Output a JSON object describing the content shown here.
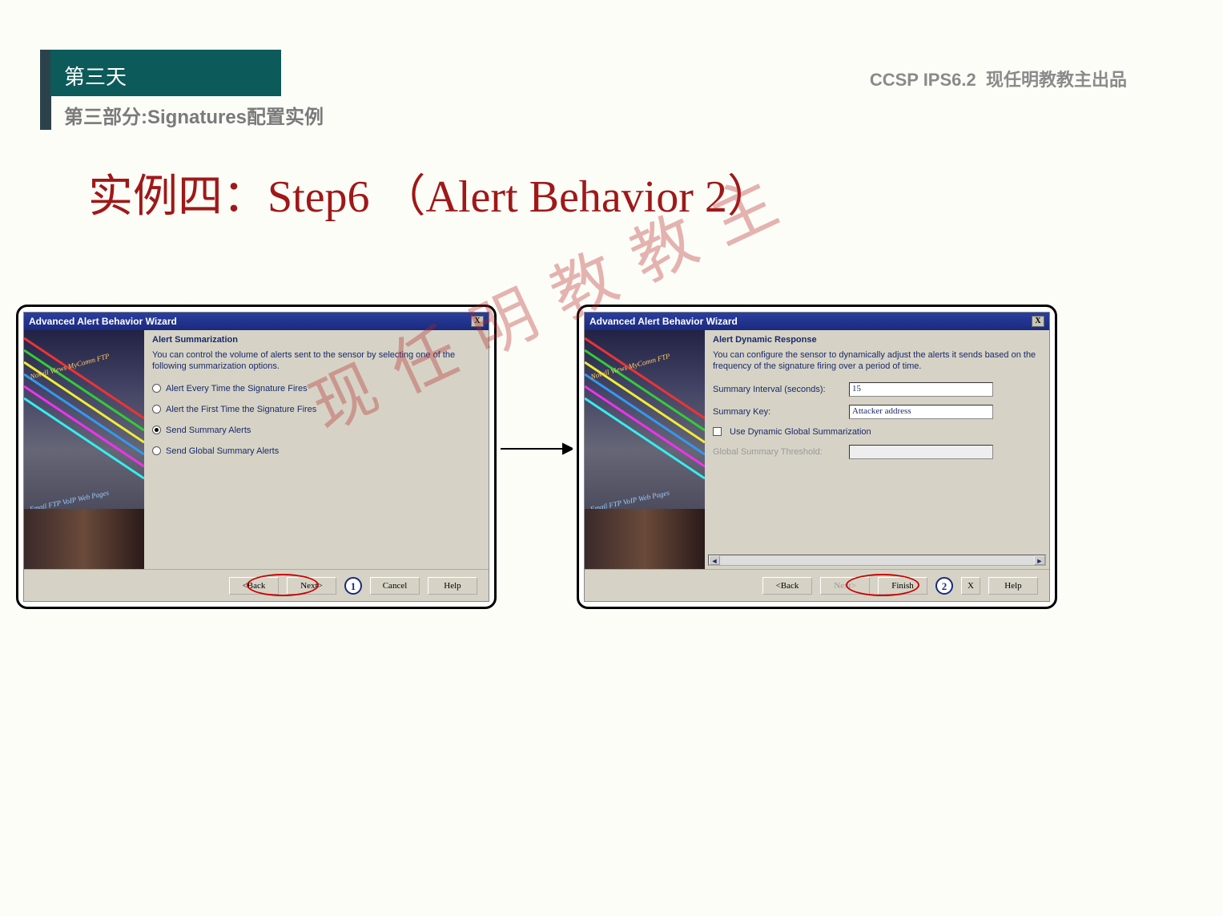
{
  "header": {
    "day": "第三天",
    "part": "第三部分:Signatures配置实例",
    "course": "CCSP IPS6.2",
    "author": "现任明教教主出品"
  },
  "title": "实例四：Step6 （Alert Behavior 2）",
  "watermark": "现任明教教主",
  "side_tags": {
    "top": "Novell\nViews\nMyComm\nFTP",
    "bottom": "Email FTP VoIP Web Pages"
  },
  "dialog_left": {
    "window_title": "Advanced Alert Behavior Wizard",
    "panel_title": "Alert Summarization",
    "panel_desc": "You can control the volume of alerts sent to the sensor by selecting one of the following summarization options.",
    "options": [
      "Alert Every Time the Signature Fires",
      "Alert the First Time the Signature Fires",
      "Send Summary Alerts",
      "Send Global Summary Alerts"
    ],
    "selected_index": 2,
    "buttons": {
      "back": "<Back",
      "next": "Next>",
      "cancel": "Cancel",
      "help": "Help"
    },
    "callout_number": "1"
  },
  "dialog_right": {
    "window_title": "Advanced Alert Behavior Wizard",
    "panel_title": "Alert Dynamic Response",
    "panel_desc": "You can configure the sensor to dynamically adjust the alerts it sends based on the frequency of the signature firing over a period of time.",
    "fields": {
      "interval_label": "Summary Interval (seconds):",
      "interval_value": "15",
      "key_label": "Summary Key:",
      "key_value": "Attacker address",
      "use_dynamic": "Use Dynamic Global Summarization",
      "threshold_label": "Global Summary Threshold:"
    },
    "buttons": {
      "back": "<Back",
      "next": "Next>",
      "finish": "Finish",
      "cancel_x": "X",
      "help": "Help"
    },
    "callout_number": "2"
  },
  "icons": {
    "close": "X"
  }
}
